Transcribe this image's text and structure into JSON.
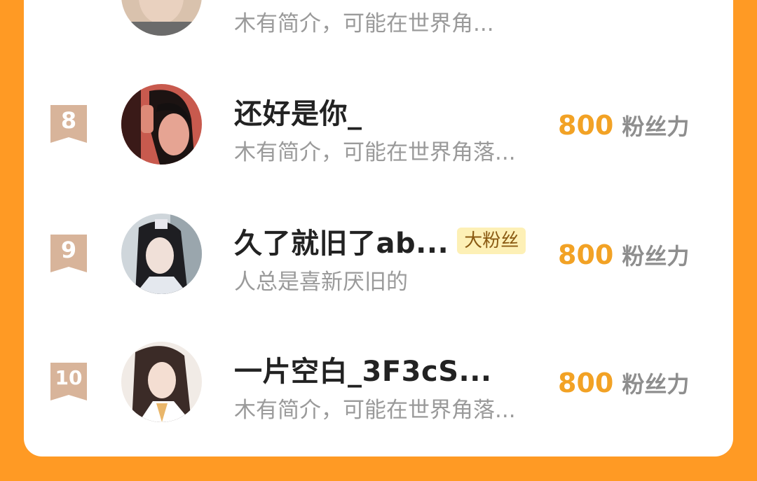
{
  "rows": [
    {
      "rank": "",
      "name": "",
      "badge": "",
      "desc": "木有简介，可能在世界角...",
      "power": "",
      "unit": ""
    },
    {
      "rank": "8",
      "name": "还好是你_",
      "badge": "",
      "desc": "木有简介，可能在世界角落...",
      "power": "800",
      "unit": "粉丝力"
    },
    {
      "rank": "9",
      "name": "久了就旧了ab...",
      "badge": "大粉丝",
      "desc": "人总是喜新厌旧的",
      "power": "800",
      "unit": "粉丝力"
    },
    {
      "rank": "10",
      "name": "一片空白_3F3cS...",
      "badge": "",
      "desc": "木有简介，可能在世界角落...",
      "power": "800",
      "unit": "粉丝力"
    }
  ],
  "colors": {
    "background_orange": "#ff9a24",
    "power_orange": "#f2a225",
    "rank_ribbon": "#d8b49a",
    "badge_bg": "#fdf0b6"
  },
  "icons": {
    "rank": "ribbon-rank-icon"
  }
}
